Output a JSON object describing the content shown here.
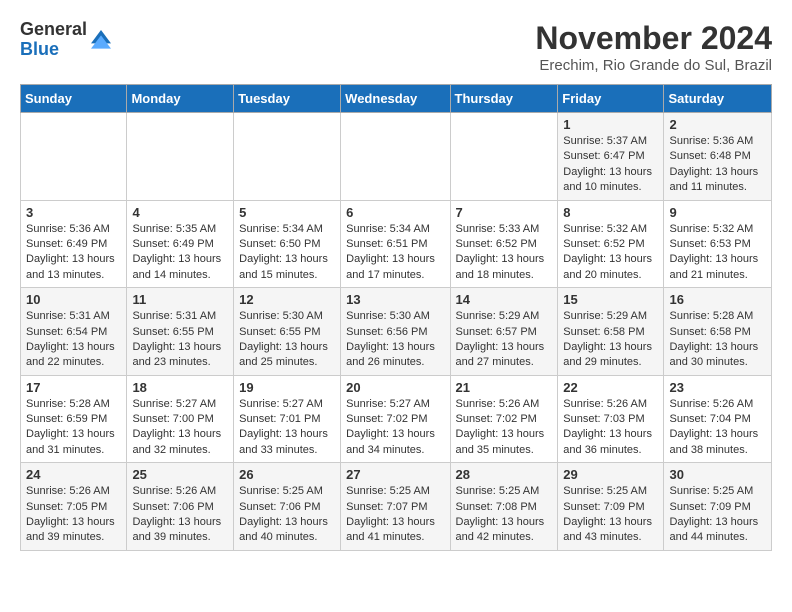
{
  "logo": {
    "general": "General",
    "blue": "Blue"
  },
  "title": "November 2024",
  "location": "Erechim, Rio Grande do Sul, Brazil",
  "weekdays": [
    "Sunday",
    "Monday",
    "Tuesday",
    "Wednesday",
    "Thursday",
    "Friday",
    "Saturday"
  ],
  "weeks": [
    [
      {
        "day": "",
        "info": ""
      },
      {
        "day": "",
        "info": ""
      },
      {
        "day": "",
        "info": ""
      },
      {
        "day": "",
        "info": ""
      },
      {
        "day": "",
        "info": ""
      },
      {
        "day": "1",
        "info": "Sunrise: 5:37 AM\nSunset: 6:47 PM\nDaylight: 13 hours and 10 minutes."
      },
      {
        "day": "2",
        "info": "Sunrise: 5:36 AM\nSunset: 6:48 PM\nDaylight: 13 hours and 11 minutes."
      }
    ],
    [
      {
        "day": "3",
        "info": "Sunrise: 5:36 AM\nSunset: 6:49 PM\nDaylight: 13 hours and 13 minutes."
      },
      {
        "day": "4",
        "info": "Sunrise: 5:35 AM\nSunset: 6:49 PM\nDaylight: 13 hours and 14 minutes."
      },
      {
        "day": "5",
        "info": "Sunrise: 5:34 AM\nSunset: 6:50 PM\nDaylight: 13 hours and 15 minutes."
      },
      {
        "day": "6",
        "info": "Sunrise: 5:34 AM\nSunset: 6:51 PM\nDaylight: 13 hours and 17 minutes."
      },
      {
        "day": "7",
        "info": "Sunrise: 5:33 AM\nSunset: 6:52 PM\nDaylight: 13 hours and 18 minutes."
      },
      {
        "day": "8",
        "info": "Sunrise: 5:32 AM\nSunset: 6:52 PM\nDaylight: 13 hours and 20 minutes."
      },
      {
        "day": "9",
        "info": "Sunrise: 5:32 AM\nSunset: 6:53 PM\nDaylight: 13 hours and 21 minutes."
      }
    ],
    [
      {
        "day": "10",
        "info": "Sunrise: 5:31 AM\nSunset: 6:54 PM\nDaylight: 13 hours and 22 minutes."
      },
      {
        "day": "11",
        "info": "Sunrise: 5:31 AM\nSunset: 6:55 PM\nDaylight: 13 hours and 23 minutes."
      },
      {
        "day": "12",
        "info": "Sunrise: 5:30 AM\nSunset: 6:55 PM\nDaylight: 13 hours and 25 minutes."
      },
      {
        "day": "13",
        "info": "Sunrise: 5:30 AM\nSunset: 6:56 PM\nDaylight: 13 hours and 26 minutes."
      },
      {
        "day": "14",
        "info": "Sunrise: 5:29 AM\nSunset: 6:57 PM\nDaylight: 13 hours and 27 minutes."
      },
      {
        "day": "15",
        "info": "Sunrise: 5:29 AM\nSunset: 6:58 PM\nDaylight: 13 hours and 29 minutes."
      },
      {
        "day": "16",
        "info": "Sunrise: 5:28 AM\nSunset: 6:58 PM\nDaylight: 13 hours and 30 minutes."
      }
    ],
    [
      {
        "day": "17",
        "info": "Sunrise: 5:28 AM\nSunset: 6:59 PM\nDaylight: 13 hours and 31 minutes."
      },
      {
        "day": "18",
        "info": "Sunrise: 5:27 AM\nSunset: 7:00 PM\nDaylight: 13 hours and 32 minutes."
      },
      {
        "day": "19",
        "info": "Sunrise: 5:27 AM\nSunset: 7:01 PM\nDaylight: 13 hours and 33 minutes."
      },
      {
        "day": "20",
        "info": "Sunrise: 5:27 AM\nSunset: 7:02 PM\nDaylight: 13 hours and 34 minutes."
      },
      {
        "day": "21",
        "info": "Sunrise: 5:26 AM\nSunset: 7:02 PM\nDaylight: 13 hours and 35 minutes."
      },
      {
        "day": "22",
        "info": "Sunrise: 5:26 AM\nSunset: 7:03 PM\nDaylight: 13 hours and 36 minutes."
      },
      {
        "day": "23",
        "info": "Sunrise: 5:26 AM\nSunset: 7:04 PM\nDaylight: 13 hours and 38 minutes."
      }
    ],
    [
      {
        "day": "24",
        "info": "Sunrise: 5:26 AM\nSunset: 7:05 PM\nDaylight: 13 hours and 39 minutes."
      },
      {
        "day": "25",
        "info": "Sunrise: 5:26 AM\nSunset: 7:06 PM\nDaylight: 13 hours and 39 minutes."
      },
      {
        "day": "26",
        "info": "Sunrise: 5:25 AM\nSunset: 7:06 PM\nDaylight: 13 hours and 40 minutes."
      },
      {
        "day": "27",
        "info": "Sunrise: 5:25 AM\nSunset: 7:07 PM\nDaylight: 13 hours and 41 minutes."
      },
      {
        "day": "28",
        "info": "Sunrise: 5:25 AM\nSunset: 7:08 PM\nDaylight: 13 hours and 42 minutes."
      },
      {
        "day": "29",
        "info": "Sunrise: 5:25 AM\nSunset: 7:09 PM\nDaylight: 13 hours and 43 minutes."
      },
      {
        "day": "30",
        "info": "Sunrise: 5:25 AM\nSunset: 7:09 PM\nDaylight: 13 hours and 44 minutes."
      }
    ]
  ]
}
